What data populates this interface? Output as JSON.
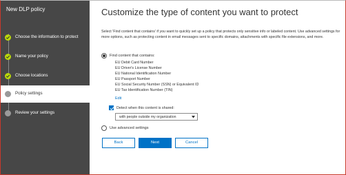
{
  "sidebar": {
    "title": "New DLP policy",
    "steps": [
      {
        "label": "Choose the information to protect",
        "state": "complete"
      },
      {
        "label": "Name your policy",
        "state": "complete"
      },
      {
        "label": "Choose locations",
        "state": "complete"
      },
      {
        "label": "Policy settings",
        "state": "current"
      },
      {
        "label": "Review your settings",
        "state": "pending"
      }
    ]
  },
  "main": {
    "title": "Customize the type of content you want to protect",
    "description": "Select 'Find content that contains' if you want to quickly set up a policy that protects only sensitive info or labeled content. Use advanced settings for more options, such as protecting content in email messages sent to specific domains, attachments with specific file extensions, and more.",
    "option_find": {
      "label": "Find content that contains:",
      "selected": true,
      "items": [
        "EU Debit Card Number",
        "EU Driver's License Number",
        "EU National Identification Number",
        "EU Passport Number",
        "EU Social Security Number (SSN) or Equivalent ID",
        "EU Tax Identification Number (TIN)"
      ],
      "edit_label": "Edit"
    },
    "detect": {
      "label": "Detect when this content is shared:",
      "checked": true,
      "select_value": "with people outside my organization"
    },
    "option_advanced": {
      "label": "Use advanced settings",
      "selected": false
    },
    "buttons": {
      "back": "Back",
      "next": "Next",
      "cancel": "Cancel"
    }
  },
  "colors": {
    "sidebar_bg": "#474747",
    "complete_dot": "#bad80a",
    "accent": "#0072c6"
  }
}
